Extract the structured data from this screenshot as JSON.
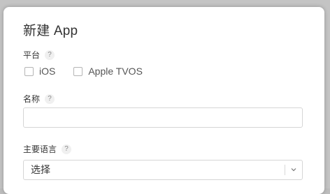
{
  "dialog": {
    "title": "新建 App",
    "help_glyph": "?",
    "platform": {
      "label": "平台",
      "options": [
        "iOS",
        "Apple TVOS"
      ],
      "checked": [
        false,
        false
      ]
    },
    "name": {
      "label": "名称",
      "value": ""
    },
    "language": {
      "label": "主要语言",
      "selected": "选择"
    }
  }
}
